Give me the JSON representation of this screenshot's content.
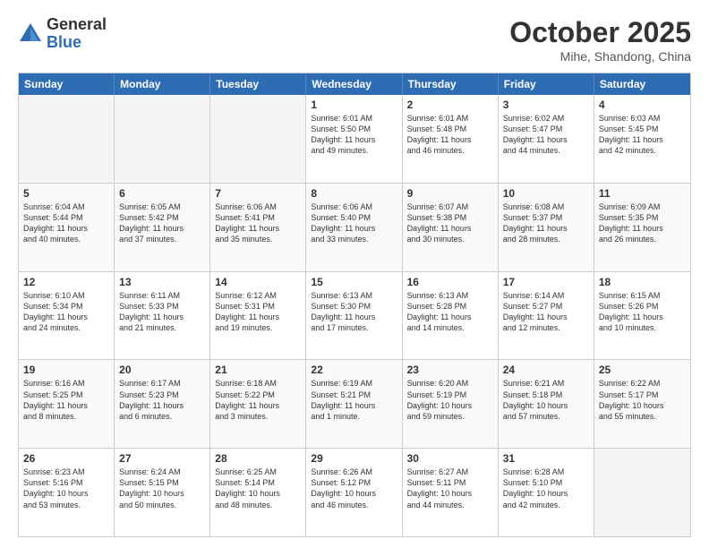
{
  "logo": {
    "general": "General",
    "blue": "Blue"
  },
  "title": "October 2025",
  "location": "Mihe, Shandong, China",
  "days": [
    "Sunday",
    "Monday",
    "Tuesday",
    "Wednesday",
    "Thursday",
    "Friday",
    "Saturday"
  ],
  "rows": [
    [
      {
        "day": "",
        "lines": []
      },
      {
        "day": "",
        "lines": []
      },
      {
        "day": "",
        "lines": []
      },
      {
        "day": "1",
        "lines": [
          "Sunrise: 6:01 AM",
          "Sunset: 5:50 PM",
          "Daylight: 11 hours",
          "and 49 minutes."
        ]
      },
      {
        "day": "2",
        "lines": [
          "Sunrise: 6:01 AM",
          "Sunset: 5:48 PM",
          "Daylight: 11 hours",
          "and 46 minutes."
        ]
      },
      {
        "day": "3",
        "lines": [
          "Sunrise: 6:02 AM",
          "Sunset: 5:47 PM",
          "Daylight: 11 hours",
          "and 44 minutes."
        ]
      },
      {
        "day": "4",
        "lines": [
          "Sunrise: 6:03 AM",
          "Sunset: 5:45 PM",
          "Daylight: 11 hours",
          "and 42 minutes."
        ]
      }
    ],
    [
      {
        "day": "5",
        "lines": [
          "Sunrise: 6:04 AM",
          "Sunset: 5:44 PM",
          "Daylight: 11 hours",
          "and 40 minutes."
        ]
      },
      {
        "day": "6",
        "lines": [
          "Sunrise: 6:05 AM",
          "Sunset: 5:42 PM",
          "Daylight: 11 hours",
          "and 37 minutes."
        ]
      },
      {
        "day": "7",
        "lines": [
          "Sunrise: 6:06 AM",
          "Sunset: 5:41 PM",
          "Daylight: 11 hours",
          "and 35 minutes."
        ]
      },
      {
        "day": "8",
        "lines": [
          "Sunrise: 6:06 AM",
          "Sunset: 5:40 PM",
          "Daylight: 11 hours",
          "and 33 minutes."
        ]
      },
      {
        "day": "9",
        "lines": [
          "Sunrise: 6:07 AM",
          "Sunset: 5:38 PM",
          "Daylight: 11 hours",
          "and 30 minutes."
        ]
      },
      {
        "day": "10",
        "lines": [
          "Sunrise: 6:08 AM",
          "Sunset: 5:37 PM",
          "Daylight: 11 hours",
          "and 28 minutes."
        ]
      },
      {
        "day": "11",
        "lines": [
          "Sunrise: 6:09 AM",
          "Sunset: 5:35 PM",
          "Daylight: 11 hours",
          "and 26 minutes."
        ]
      }
    ],
    [
      {
        "day": "12",
        "lines": [
          "Sunrise: 6:10 AM",
          "Sunset: 5:34 PM",
          "Daylight: 11 hours",
          "and 24 minutes."
        ]
      },
      {
        "day": "13",
        "lines": [
          "Sunrise: 6:11 AM",
          "Sunset: 5:33 PM",
          "Daylight: 11 hours",
          "and 21 minutes."
        ]
      },
      {
        "day": "14",
        "lines": [
          "Sunrise: 6:12 AM",
          "Sunset: 5:31 PM",
          "Daylight: 11 hours",
          "and 19 minutes."
        ]
      },
      {
        "day": "15",
        "lines": [
          "Sunrise: 6:13 AM",
          "Sunset: 5:30 PM",
          "Daylight: 11 hours",
          "and 17 minutes."
        ]
      },
      {
        "day": "16",
        "lines": [
          "Sunrise: 6:13 AM",
          "Sunset: 5:28 PM",
          "Daylight: 11 hours",
          "and 14 minutes."
        ]
      },
      {
        "day": "17",
        "lines": [
          "Sunrise: 6:14 AM",
          "Sunset: 5:27 PM",
          "Daylight: 11 hours",
          "and 12 minutes."
        ]
      },
      {
        "day": "18",
        "lines": [
          "Sunrise: 6:15 AM",
          "Sunset: 5:26 PM",
          "Daylight: 11 hours",
          "and 10 minutes."
        ]
      }
    ],
    [
      {
        "day": "19",
        "lines": [
          "Sunrise: 6:16 AM",
          "Sunset: 5:25 PM",
          "Daylight: 11 hours",
          "and 8 minutes."
        ]
      },
      {
        "day": "20",
        "lines": [
          "Sunrise: 6:17 AM",
          "Sunset: 5:23 PM",
          "Daylight: 11 hours",
          "and 6 minutes."
        ]
      },
      {
        "day": "21",
        "lines": [
          "Sunrise: 6:18 AM",
          "Sunset: 5:22 PM",
          "Daylight: 11 hours",
          "and 3 minutes."
        ]
      },
      {
        "day": "22",
        "lines": [
          "Sunrise: 6:19 AM",
          "Sunset: 5:21 PM",
          "Daylight: 11 hours",
          "and 1 minute."
        ]
      },
      {
        "day": "23",
        "lines": [
          "Sunrise: 6:20 AM",
          "Sunset: 5:19 PM",
          "Daylight: 10 hours",
          "and 59 minutes."
        ]
      },
      {
        "day": "24",
        "lines": [
          "Sunrise: 6:21 AM",
          "Sunset: 5:18 PM",
          "Daylight: 10 hours",
          "and 57 minutes."
        ]
      },
      {
        "day": "25",
        "lines": [
          "Sunrise: 6:22 AM",
          "Sunset: 5:17 PM",
          "Daylight: 10 hours",
          "and 55 minutes."
        ]
      }
    ],
    [
      {
        "day": "26",
        "lines": [
          "Sunrise: 6:23 AM",
          "Sunset: 5:16 PM",
          "Daylight: 10 hours",
          "and 53 minutes."
        ]
      },
      {
        "day": "27",
        "lines": [
          "Sunrise: 6:24 AM",
          "Sunset: 5:15 PM",
          "Daylight: 10 hours",
          "and 50 minutes."
        ]
      },
      {
        "day": "28",
        "lines": [
          "Sunrise: 6:25 AM",
          "Sunset: 5:14 PM",
          "Daylight: 10 hours",
          "and 48 minutes."
        ]
      },
      {
        "day": "29",
        "lines": [
          "Sunrise: 6:26 AM",
          "Sunset: 5:12 PM",
          "Daylight: 10 hours",
          "and 46 minutes."
        ]
      },
      {
        "day": "30",
        "lines": [
          "Sunrise: 6:27 AM",
          "Sunset: 5:11 PM",
          "Daylight: 10 hours",
          "and 44 minutes."
        ]
      },
      {
        "day": "31",
        "lines": [
          "Sunrise: 6:28 AM",
          "Sunset: 5:10 PM",
          "Daylight: 10 hours",
          "and 42 minutes."
        ]
      },
      {
        "day": "",
        "lines": []
      }
    ]
  ]
}
